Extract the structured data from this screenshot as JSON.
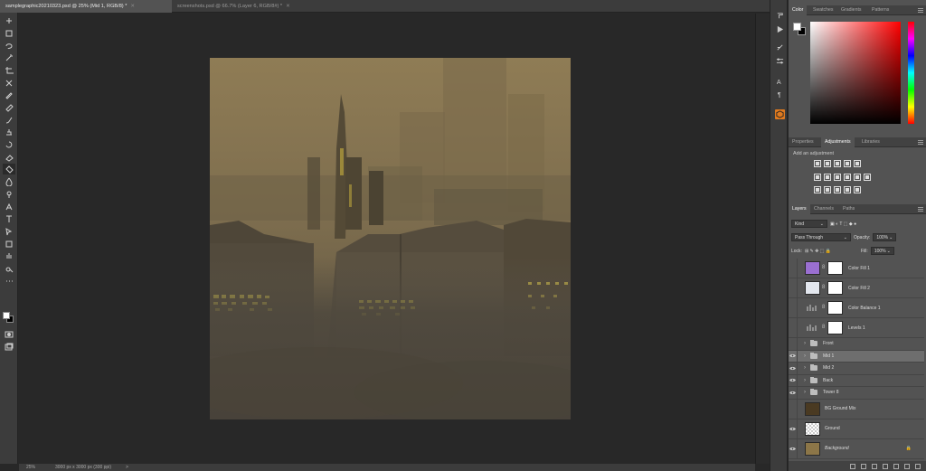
{
  "document_tabs": [
    {
      "label": "samplegraphic20210323.psd @ 25% (Mid 1, RGB/8) *",
      "active": true
    },
    {
      "label": "screenshots.psd @ 66.7% (Layer 6, RGB/8#) *",
      "active": false
    }
  ],
  "status_bar": {
    "zoom": "25%",
    "doc_size": "3000 px x 3000 px (300 ppi)",
    "arrow": ">"
  },
  "tools": [
    "move-tool",
    "artboard-marquee-tool",
    "lasso-tool",
    "magic-wand-tool",
    "crop-tool",
    "frame-tool",
    "eyedropper-tool",
    "healing-brush-tool",
    "brush-tool",
    "clone-stamp-tool",
    "history-brush-tool",
    "eraser-tool",
    "paint-bucket-tool",
    "blur-tool",
    "dodge-tool",
    "pen-tool",
    "type-tool",
    "path-selection-tool",
    "rectangle-tool",
    "hand-tool",
    "zoom-tool",
    "more-tools"
  ],
  "color_panel": {
    "tabs": [
      "Color",
      "Swatches",
      "Gradients",
      "Patterns"
    ],
    "active_tab": "Color",
    "foreground": "#ffffff",
    "background": "#000000"
  },
  "adjustments_panel": {
    "tabs": [
      "Properties",
      "Adjustments",
      "Libraries"
    ],
    "active_tab": "Adjustments",
    "label": "Add an adjustment"
  },
  "layers_panel": {
    "tabs": [
      "Layers",
      "Channels",
      "Paths"
    ],
    "active_tab": "Layers",
    "filter": "Kind",
    "blend_mode": "Pass Through",
    "opacity_label": "Opacity:",
    "opacity": "100%",
    "lock_label": "Lock:",
    "fill_label": "Fill:",
    "fill": "100%",
    "layers": [
      {
        "name": "Color Fill 1",
        "type": "fill",
        "thumb": "#9a6fd1",
        "visible": false,
        "selected": false
      },
      {
        "name": "Color Fill 2",
        "type": "fill",
        "thumb": "#e3e7ee",
        "visible": false,
        "selected": false
      },
      {
        "name": "Color Balance 1",
        "type": "adjustment",
        "thumb": "",
        "visible": false,
        "selected": false
      },
      {
        "name": "Levels 1",
        "type": "adjustment",
        "thumb": "",
        "visible": false,
        "selected": false
      },
      {
        "name": "Front",
        "type": "group",
        "thumb": "",
        "visible": false,
        "selected": false
      },
      {
        "name": "Mid 1",
        "type": "group",
        "thumb": "",
        "visible": true,
        "selected": true
      },
      {
        "name": "Mid 2",
        "type": "group",
        "thumb": "",
        "visible": true,
        "selected": false
      },
      {
        "name": "Back",
        "type": "group",
        "thumb": "",
        "visible": true,
        "selected": false
      },
      {
        "name": "Tower 8",
        "type": "group",
        "thumb": "",
        "visible": true,
        "selected": false
      },
      {
        "name": "BG Ground Mix",
        "type": "pixel",
        "thumb": "#4a3a22",
        "visible": false,
        "selected": false
      },
      {
        "name": "Ground",
        "type": "pixel",
        "thumb": "#3d372d",
        "visible": true,
        "selected": false
      },
      {
        "name": "Background",
        "type": "background",
        "thumb": "#8c7648",
        "visible": true,
        "selected": false
      }
    ]
  },
  "canvas": {
    "sky_top": "#8a7752",
    "sky_bottom": "#5c533f",
    "fog": "#4a4439",
    "lights": "#d4c046"
  }
}
